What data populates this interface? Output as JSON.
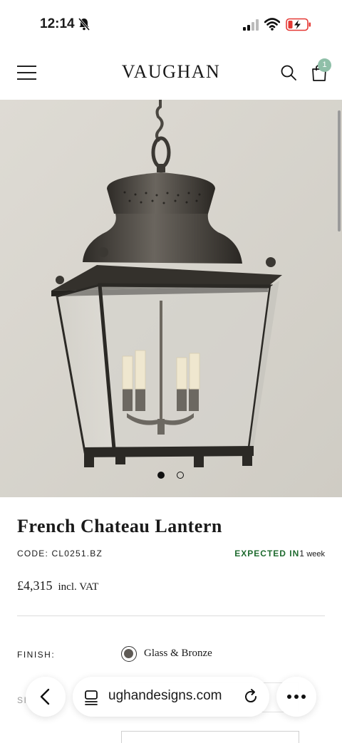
{
  "status_bar": {
    "time": "12:14",
    "icons": [
      "bell-slash-icon",
      "signal-icon",
      "wifi-icon",
      "battery-charging-icon"
    ]
  },
  "header": {
    "brand": "VAUGHAN",
    "cart_count": "1",
    "icons": [
      "menu-icon",
      "search-icon",
      "bag-icon"
    ]
  },
  "hero": {
    "carousel_total": 2,
    "carousel_active": 1
  },
  "product": {
    "title": "French Chateau Lantern",
    "code": "CODE: CL0251.BZ",
    "availability_label": "EXPECTED IN",
    "availability_eta_num": "1",
    "availability_eta_unit": "week",
    "price": "£4,315",
    "vat": "incl. VAT"
  },
  "options": {
    "finish_label": "FINISH:",
    "finish_value": "Glass & Bronze",
    "size_label_partial": "SI"
  },
  "browser": {
    "url": "ughandesigns.com"
  },
  "colors": {
    "availability": "#1f6b2f",
    "badge": "#8fbfa8",
    "hero_bg": "#d8d5ce"
  }
}
